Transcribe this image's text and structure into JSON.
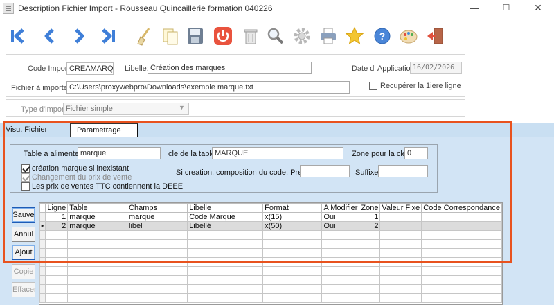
{
  "window": {
    "title": "Description Fichier Import - Rousseau Quincaillerie formation 040226",
    "minimize": "—",
    "maximize": "☐",
    "close": "✕"
  },
  "toolbar": {
    "items": [
      "first-icon",
      "previous-icon",
      "next-icon",
      "last-icon",
      "eraser-icon",
      "copy-icon",
      "save-icon",
      "power-icon",
      "trash-icon",
      "search-icon",
      "settings-icon",
      "print-icon",
      "favorite-icon",
      "help-icon",
      "palette-icon",
      "exit-icon"
    ]
  },
  "header": {
    "code_label": "Code Import:",
    "code_value": "CREAMARQ",
    "libelle_label": "Libelle:",
    "libelle_value": "Création des marques",
    "date_label": "Date d' Application:",
    "date_value": "16/02/2026",
    "file_label": "Fichier à importer:",
    "file_value": "C:\\Users\\proxywebpro\\Downloads\\exemple marque.txt",
    "first_line_label": "Recupérer la 1iere ligne",
    "type_label": "Type d'import:",
    "type_value": "Fichier simple"
  },
  "tabs": [
    "Visu. Fichier",
    "Parametrage"
  ],
  "param": {
    "table_label": "Table a alimenter:",
    "table_value": "marque",
    "cle_label": "cle de la table:",
    "cle_value": "MARQUE",
    "zone_label": "Zone pour la cle:",
    "zone_value": "0",
    "create_label": "création marque si inexistant",
    "price_change_label": "Changement du prix de vente",
    "deee_label": "Les prix de ventes TTC contiennent la DEEE",
    "prefix_label": "Si creation, composition du code, Prefixe:",
    "prefix_value": "",
    "suffix_label": "Suffixe:",
    "suffix_value": ""
  },
  "grid_buttons": [
    "Sauve",
    "Annul",
    "Ajout",
    "Copie",
    "Effacer"
  ],
  "grid": {
    "columns": [
      "Ligne",
      "Table",
      "Champs",
      "Libelle",
      "Format",
      "A Modifier",
      "Zone",
      "Valeur Fixe",
      "Code Correspondance"
    ],
    "rows": [
      [
        "1",
        "marque",
        "marque",
        "Code Marque",
        "x(15)",
        "Oui",
        "1",
        "",
        ""
      ],
      [
        "2",
        "marque",
        "libel",
        "Libellé",
        "x(50)",
        "Oui",
        "2",
        "",
        ""
      ]
    ]
  },
  "colors": {
    "accent_highlight": "#e8521e",
    "tab_background": "#c9dff2",
    "selected_row": "#dcdcdc"
  }
}
